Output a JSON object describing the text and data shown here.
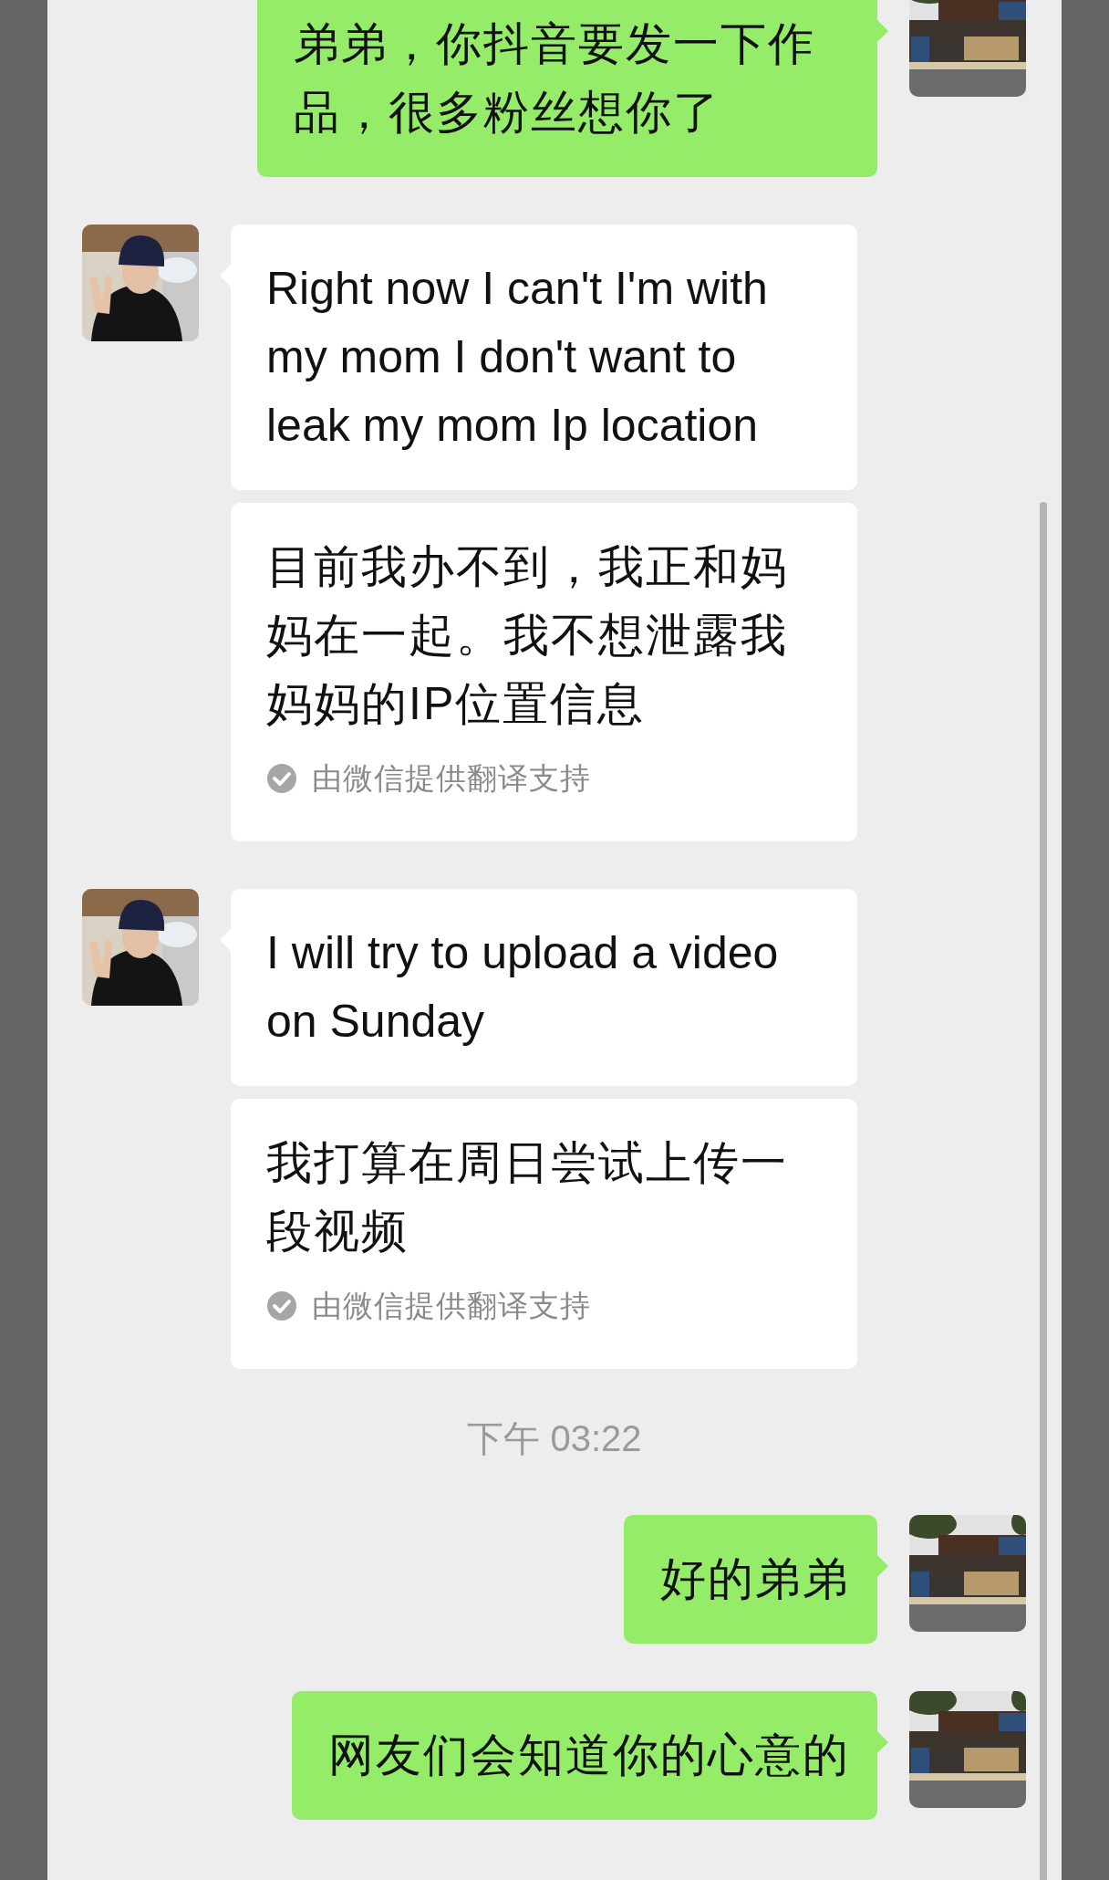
{
  "messages": [
    {
      "kind": "sent",
      "text": "弟弟，你抖音要发一下作品，很多粉丝想你了"
    },
    {
      "kind": "received",
      "text": "Right now I can't I'm with my mom I don't want to leak my mom Ip location"
    },
    {
      "kind": "translation",
      "text": "目前我办不到，我正和妈妈在一起。我不想泄露我妈妈的IP位置信息",
      "note": "由微信提供翻译支持"
    },
    {
      "kind": "received",
      "text": "I will try to upload a video on Sunday"
    },
    {
      "kind": "translation",
      "text": "我打算在周日尝试上传一段视频",
      "note": "由微信提供翻译支持"
    },
    {
      "kind": "time",
      "text": "下午 03:22"
    },
    {
      "kind": "sent",
      "text": "好的弟弟"
    },
    {
      "kind": "sent",
      "text": "网友们会知道你的心意的"
    }
  ]
}
